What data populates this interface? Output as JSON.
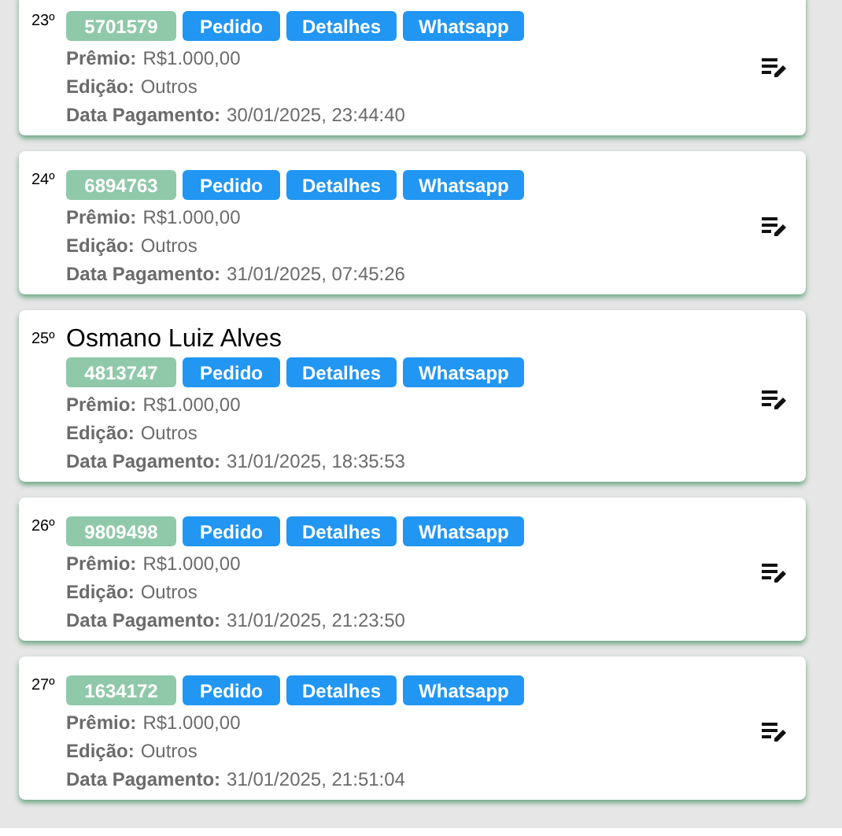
{
  "entries": [
    {
      "position": "23º",
      "code": "5701579",
      "buttons": [
        "Pedido",
        "Detalhes",
        "Whatsapp"
      ],
      "fields": [
        {
          "label": "Prêmio:",
          "value": "R$1.000,00"
        },
        {
          "label": "Edição:",
          "value": "Outros"
        },
        {
          "label": "Data Pagamento:",
          "value": "30/01/2025, 23:44:40"
        }
      ]
    },
    {
      "position": "24º",
      "code": "6894763",
      "buttons": [
        "Pedido",
        "Detalhes",
        "Whatsapp"
      ],
      "fields": [
        {
          "label": "Prêmio:",
          "value": "R$1.000,00"
        },
        {
          "label": "Edição:",
          "value": "Outros"
        },
        {
          "label": "Data Pagamento:",
          "value": "31/01/2025, 07:45:26"
        }
      ]
    },
    {
      "position": "25º",
      "name": "Osmano Luiz Alves",
      "code": "4813747",
      "buttons": [
        "Pedido",
        "Detalhes",
        "Whatsapp"
      ],
      "fields": [
        {
          "label": "Prêmio:",
          "value": "R$1.000,00"
        },
        {
          "label": "Edição:",
          "value": "Outros"
        },
        {
          "label": "Data Pagamento:",
          "value": "31/01/2025, 18:35:53"
        }
      ]
    },
    {
      "position": "26º",
      "code": "9809498",
      "buttons": [
        "Pedido",
        "Detalhes",
        "Whatsapp"
      ],
      "fields": [
        {
          "label": "Prêmio:",
          "value": "R$1.000,00"
        },
        {
          "label": "Edição:",
          "value": "Outros"
        },
        {
          "label": "Data Pagamento:",
          "value": "31/01/2025, 21:23:50"
        }
      ]
    },
    {
      "position": "27º",
      "code": "1634172",
      "buttons": [
        "Pedido",
        "Detalhes",
        "Whatsapp"
      ],
      "fields": [
        {
          "label": "Prêmio:",
          "value": "R$1.000,00"
        },
        {
          "label": "Edição:",
          "value": "Outros"
        },
        {
          "label": "Data Pagamento:",
          "value": "31/01/2025, 21:51:04"
        }
      ]
    }
  ]
}
